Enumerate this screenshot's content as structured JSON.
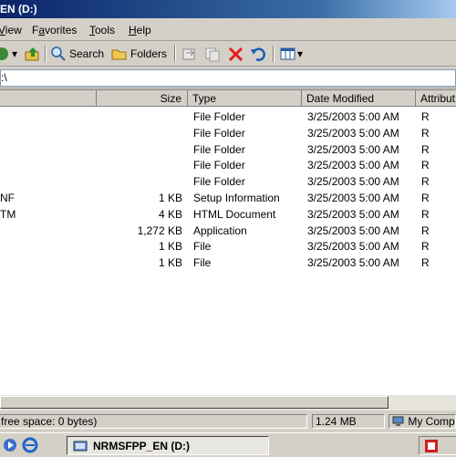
{
  "window": {
    "title": "EN (D:)"
  },
  "menu": [
    {
      "label": "View",
      "accel": "V"
    },
    {
      "label": "Favorites",
      "accel": "a"
    },
    {
      "label": "Tools",
      "accel": "T"
    },
    {
      "label": "Help",
      "accel": "H"
    }
  ],
  "toolbar": {
    "search_label": "Search",
    "folders_label": "Folders"
  },
  "address": {
    "value": ":\\"
  },
  "columns": [
    "Size",
    "Type",
    "Date Modified",
    "Attribut"
  ],
  "files": [
    {
      "name": "",
      "size": "",
      "type": "File Folder",
      "date": "3/25/2003 5:00 AM",
      "attr": "R"
    },
    {
      "name": "",
      "size": "",
      "type": "File Folder",
      "date": "3/25/2003 5:00 AM",
      "attr": "R"
    },
    {
      "name": "",
      "size": "",
      "type": "File Folder",
      "date": "3/25/2003 5:00 AM",
      "attr": "R"
    },
    {
      "name": "",
      "size": "",
      "type": "File Folder",
      "date": "3/25/2003 5:00 AM",
      "attr": "R"
    },
    {
      "name": "",
      "size": "",
      "type": "File Folder",
      "date": "3/25/2003 5:00 AM",
      "attr": "R"
    },
    {
      "name": "NF",
      "size": "1 KB",
      "type": "Setup Information",
      "date": "3/25/2003 5:00 AM",
      "attr": "R"
    },
    {
      "name": "TM",
      "size": "4 KB",
      "type": "HTML Document",
      "date": "3/25/2003 5:00 AM",
      "attr": "R"
    },
    {
      "name": "",
      "size": "1,272 KB",
      "type": "Application",
      "date": "3/25/2003 5:00 AM",
      "attr": "R"
    },
    {
      "name": "",
      "size": "1 KB",
      "type": "File",
      "date": "3/25/2003 5:00 AM",
      "attr": "R"
    },
    {
      "name": "",
      "size": "1 KB",
      "type": "File",
      "date": "3/25/2003 5:00 AM",
      "attr": "R"
    }
  ],
  "status": {
    "free_space": "free space: 0 bytes)",
    "size": "1.24 MB",
    "zone": "My Compu"
  },
  "taskbar": {
    "task_label": "NRMSFPP_EN (D:)"
  },
  "icons": [
    "back-icon",
    "up-folder-icon",
    "search-icon",
    "folders-icon",
    "move-to-icon",
    "copy-to-icon",
    "delete-icon",
    "undo-icon",
    "views-icon",
    "ie-icon",
    "media-player-icon",
    "explorer-task-icon",
    "computer-icon",
    "tray-icon"
  ],
  "colors": {
    "title_start": "#0a246a",
    "title_end": "#a6caf0",
    "delete_red": "#e0201b",
    "undo_blue": "#1a5fb4"
  }
}
